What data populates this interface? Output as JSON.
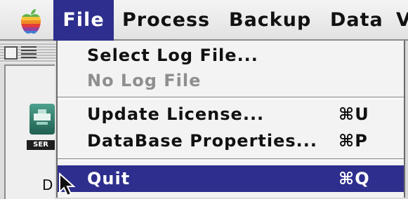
{
  "menubar": {
    "items": [
      {
        "label": "File"
      },
      {
        "label": "Process"
      },
      {
        "label": "Backup"
      },
      {
        "label": "Data"
      },
      {
        "label": "V"
      }
    ],
    "icon": "apple-icon"
  },
  "background_window": {
    "app_icon_label": "SER",
    "partial_text": "D"
  },
  "file_menu": {
    "items": [
      {
        "label": "Select Log File...",
        "shortcut": "",
        "enabled": true
      },
      {
        "label": "No Log File",
        "shortcut": "",
        "enabled": false
      },
      {
        "label": "Update License...",
        "shortcut": "⌘U",
        "enabled": true
      },
      {
        "label": "DataBase Properties...",
        "shortcut": "⌘P",
        "enabled": true
      },
      {
        "label": "Quit",
        "shortcut": "⌘Q",
        "enabled": true,
        "highlighted": true
      }
    ]
  },
  "colors": {
    "highlight": "#2e2e8e",
    "menu_background": "#f3f3f3",
    "disabled_text": "#8e8e8e"
  }
}
